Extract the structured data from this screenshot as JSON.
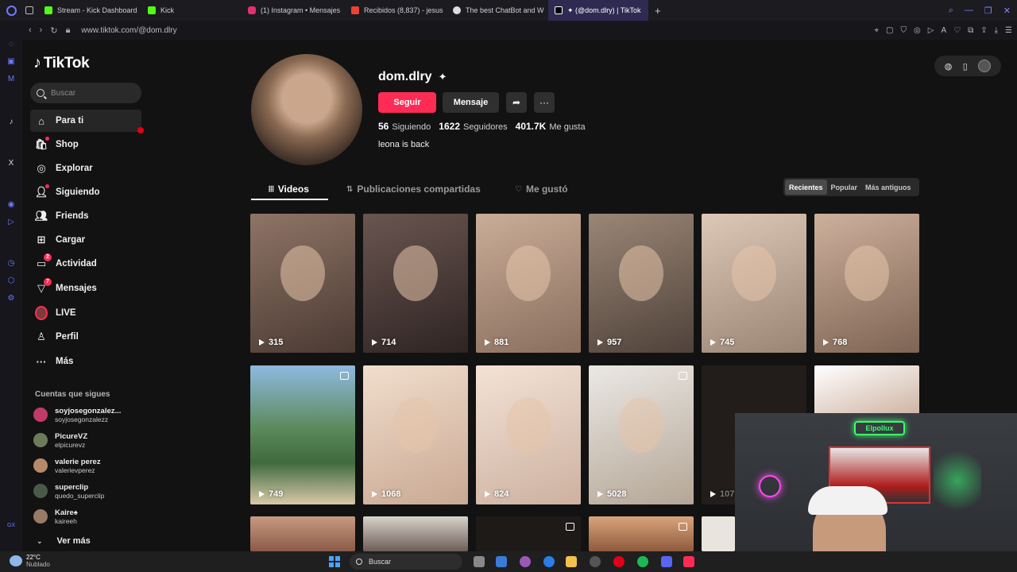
{
  "browser": {
    "tabs": [
      {
        "label": "Stream - Kick Dashboard",
        "color": "#53fc18"
      },
      {
        "label": "Kick",
        "color": "#53fc18"
      },
      {
        "label": "(1) Instagram • Mensajes",
        "color": "#e1306c"
      },
      {
        "label": "Recibidos (8,837) - jesus",
        "color": "#ea4335"
      },
      {
        "label": "The best ChatBot and W",
        "color": "#dddddd"
      },
      {
        "label": "✦ (@dom.dlry) | TikTok",
        "color": "#ffffff"
      }
    ],
    "new_tab": "+",
    "url": "www.tiktok.com/@dom.dlry"
  },
  "sidebar": {
    "logo": "TikTok",
    "search_placeholder": "Buscar",
    "menu": [
      {
        "label": "Para ti",
        "icon": "home-icon"
      },
      {
        "label": "Shop",
        "icon": "shop-icon"
      },
      {
        "label": "Explorar",
        "icon": "compass-icon"
      },
      {
        "label": "Siguiendo",
        "icon": "following-icon"
      },
      {
        "label": "Friends",
        "icon": "friends-icon"
      },
      {
        "label": "Cargar",
        "icon": "upload-icon"
      },
      {
        "label": "Actividad",
        "icon": "activity-icon",
        "badge": "2"
      },
      {
        "label": "Mensajes",
        "icon": "messages-icon",
        "badge": "7"
      },
      {
        "label": "LIVE",
        "icon": "live-icon"
      },
      {
        "label": "Perfil",
        "icon": "profile-icon"
      },
      {
        "label": "Más",
        "icon": "more-icon"
      }
    ],
    "follows_title": "Cuentas que sigues",
    "follows": [
      {
        "name": "soyjosegonzalez...",
        "handle": "soyjosegonzalezz",
        "color": "#c23a6a"
      },
      {
        "name": "PicureVZ",
        "handle": "elpicurevz",
        "color": "#6e7b5a"
      },
      {
        "name": "valerie perez",
        "handle": "valerievperez",
        "color": "#b48a6a"
      },
      {
        "name": "superclip",
        "handle": "quedo_superclip",
        "color": "#4a5a4a"
      },
      {
        "name": "Kaire♠",
        "handle": "kaireeh",
        "color": "#9a7a66"
      }
    ],
    "see_more": "Ver más"
  },
  "profile": {
    "username": "dom.dlry",
    "follow_button": "Seguir",
    "message_button": "Mensaje",
    "following_count": "56",
    "following_label": "Siguiendo",
    "followers_count": "1622",
    "followers_label": "Seguidores",
    "likes_count": "401.7K",
    "likes_label": "Me gusta",
    "bio": "leona is back"
  },
  "tabs": {
    "videos": "Videos",
    "reposts": "Publicaciones compartidas",
    "liked": "Me gustó"
  },
  "sort": {
    "recent": "Recientes",
    "popular": "Popular",
    "oldest": "Más antiguos"
  },
  "videos": [
    {
      "views": "315",
      "bg": "#7a6358"
    },
    {
      "views": "714",
      "bg": "#4a3a36"
    },
    {
      "views": "881",
      "bg": "#b79b88"
    },
    {
      "views": "957",
      "bg": "#8e7a6c"
    },
    {
      "views": "745",
      "bg": "#c8b2a0"
    },
    {
      "views": "768",
      "bg": "#b89a86"
    },
    {
      "views": "749",
      "bg": "#5a7a5a"
    },
    {
      "views": "1068",
      "bg": "#e4c9b6"
    },
    {
      "views": "824",
      "bg": "#e9d2c2"
    },
    {
      "views": "5028",
      "bg": "#d6d0c8"
    },
    {
      "views": "107",
      "bg": "#2a2420"
    },
    {
      "views": "",
      "bg": "#c7b0a4"
    }
  ],
  "webcam": {
    "sign": "Elpollux"
  },
  "taskbar": {
    "temp": "22°C",
    "weather": "Nublado",
    "search": "Buscar"
  }
}
